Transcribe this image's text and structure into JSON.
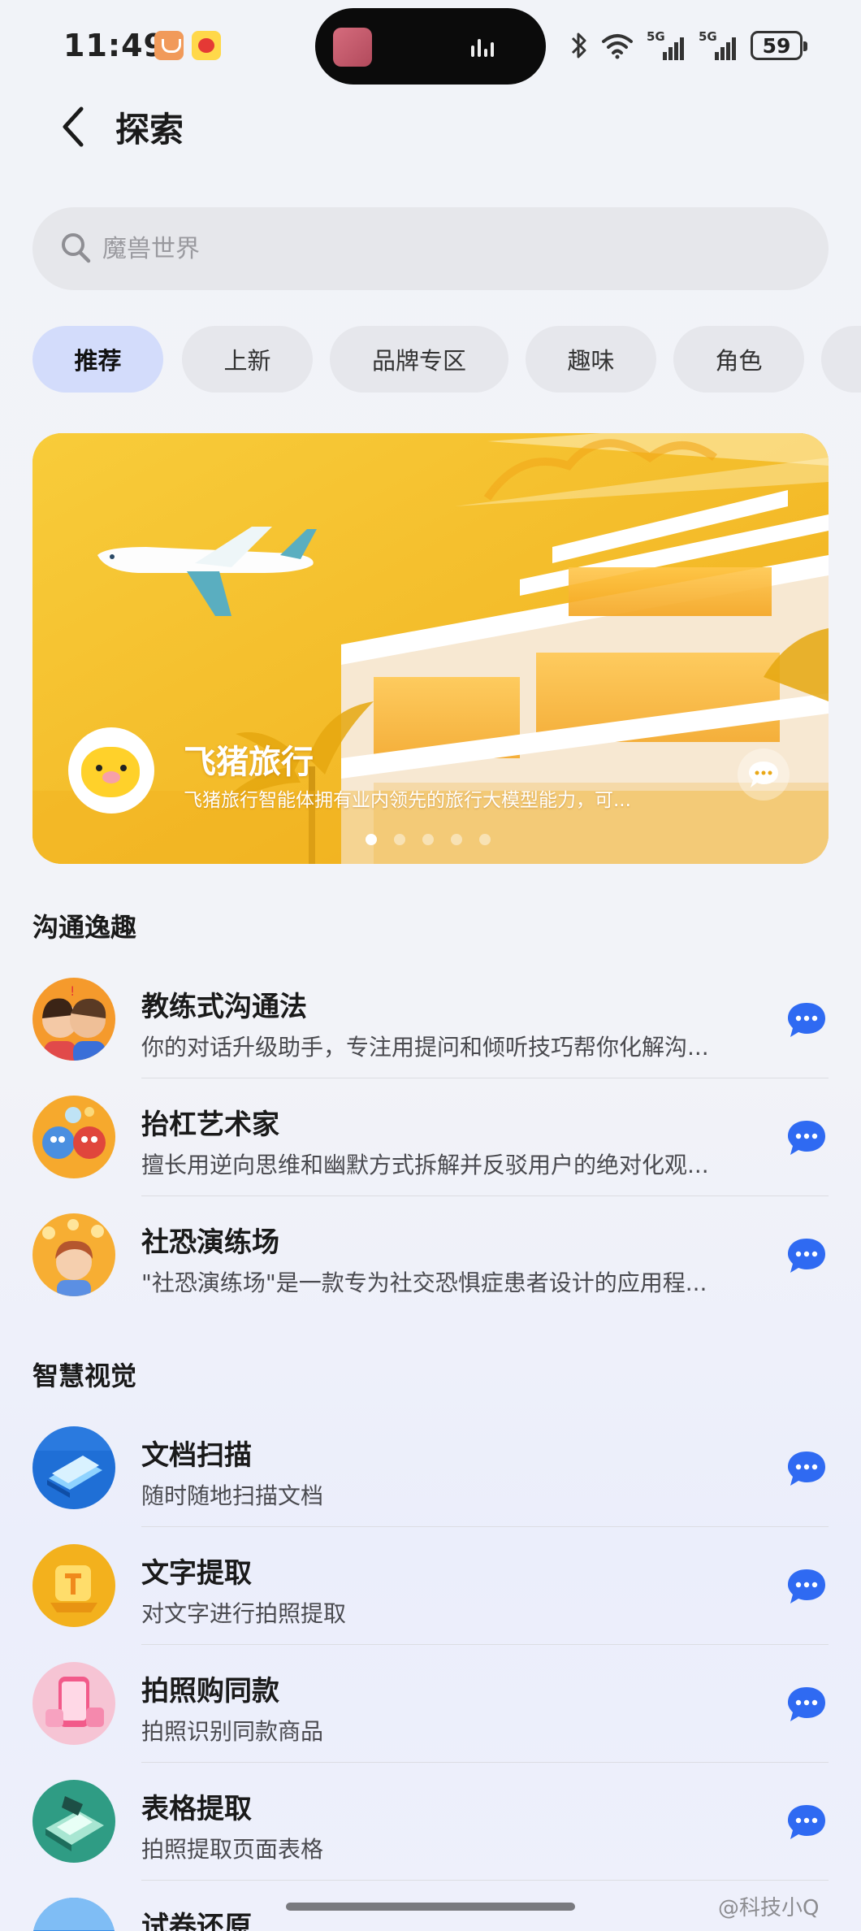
{
  "status_bar": {
    "time": "11:49",
    "signal_1": "5G",
    "signal_2": "5G",
    "battery": "59"
  },
  "header": {
    "title": "探索"
  },
  "search": {
    "placeholder": "魔兽世界"
  },
  "tabs": [
    {
      "label": "推荐",
      "active": true
    },
    {
      "label": "上新",
      "active": false
    },
    {
      "label": "品牌专区",
      "active": false
    },
    {
      "label": "趣味",
      "active": false
    },
    {
      "label": "角色",
      "active": false
    }
  ],
  "banner": {
    "title": "飞猪旅行",
    "description": "飞猪旅行智能体拥有业内领先的旅行大模型能力，可...",
    "page_count": 5,
    "active_page": 1,
    "color": "#f3bb22"
  },
  "sections": [
    {
      "title": "沟通逸趣",
      "items": [
        {
          "title": "教练式沟通法",
          "desc": "你的对话升级助手，专注用提问和倾听技巧帮你化解沟...",
          "icon": "couple-avatar"
        },
        {
          "title": "抬杠艺术家",
          "desc": "擅长用逆向思维和幽默方式拆解并反驳用户的绝对化观...",
          "icon": "debate-avatar"
        },
        {
          "title": "社恐演练场",
          "desc": "\"社恐演练场\"是一款专为社交恐惧症患者设计的应用程...",
          "icon": "social-avatar"
        }
      ]
    },
    {
      "title": "智慧视觉",
      "items": [
        {
          "title": "文档扫描",
          "desc": "随时随地扫描文档",
          "icon": "scan-avatar"
        },
        {
          "title": "文字提取",
          "desc": "对文字进行拍照提取",
          "icon": "text-extract-avatar"
        },
        {
          "title": "拍照购同款",
          "desc": "拍照识别同款商品",
          "icon": "photo-shop-avatar"
        },
        {
          "title": "表格提取",
          "desc": "拍照提取页面表格",
          "icon": "table-extract-avatar"
        },
        {
          "title": "试卷还原",
          "desc": "",
          "icon": "paper-restore-avatar"
        }
      ]
    }
  ],
  "watermark": "@科技小Q",
  "colors": {
    "accent": "#2f6af2",
    "tab_active": "#d3dcfb"
  }
}
